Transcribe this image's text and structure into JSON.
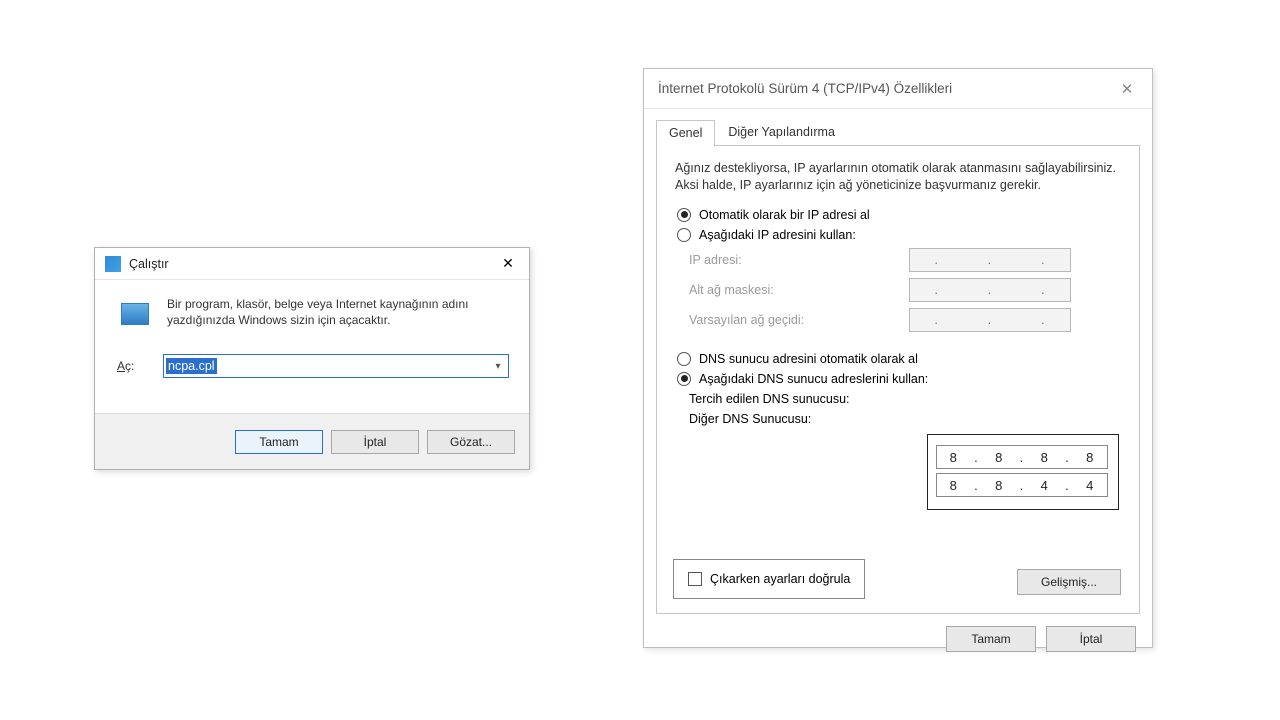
{
  "run": {
    "title": "Çalıştır",
    "description": "Bir program, klasör, belge veya Internet kaynağının adını yazdığınızda Windows sizin için açacaktır.",
    "open_label": "Aç:",
    "input_value": "ncpa.cpl",
    "ok": "Tamam",
    "cancel": "İptal",
    "browse": "Gözat..."
  },
  "ipv4": {
    "title": "İnternet Protokolü Sürüm 4 (TCP/IPv4) Özellikleri",
    "tabs": {
      "general": "Genel",
      "alt": "Diğer Yapılandırma"
    },
    "help": "Ağınız destekliyorsa, IP ayarlarının otomatik olarak atanmasını sağlayabilirsiniz. Aksi halde, IP ayarlarınız için ağ yöneticinize başvurmanız gerekir.",
    "ip_auto": "Otomatik olarak bir IP adresi al",
    "ip_manual": "Aşağıdaki IP adresini kullan:",
    "ip_addr_label": "IP adresi:",
    "subnet_label": "Alt ağ maskesi:",
    "gw_label": "Varsayılan ağ geçidi:",
    "dns_auto": "DNS sunucu adresini otomatik olarak al",
    "dns_manual": "Aşağıdaki DNS sunucu adreslerini kullan:",
    "pref_dns_label": "Tercih edilen DNS sunucusu:",
    "alt_dns_label": "Diğer DNS Sunucusu:",
    "pref_dns": [
      "8",
      "8",
      "8",
      "8"
    ],
    "alt_dns": [
      "8",
      "8",
      "4",
      "4"
    ],
    "validate": "Çıkarken ayarları doğrula",
    "advanced": "Gelişmiş...",
    "ok": "Tamam",
    "cancel": "İptal"
  }
}
